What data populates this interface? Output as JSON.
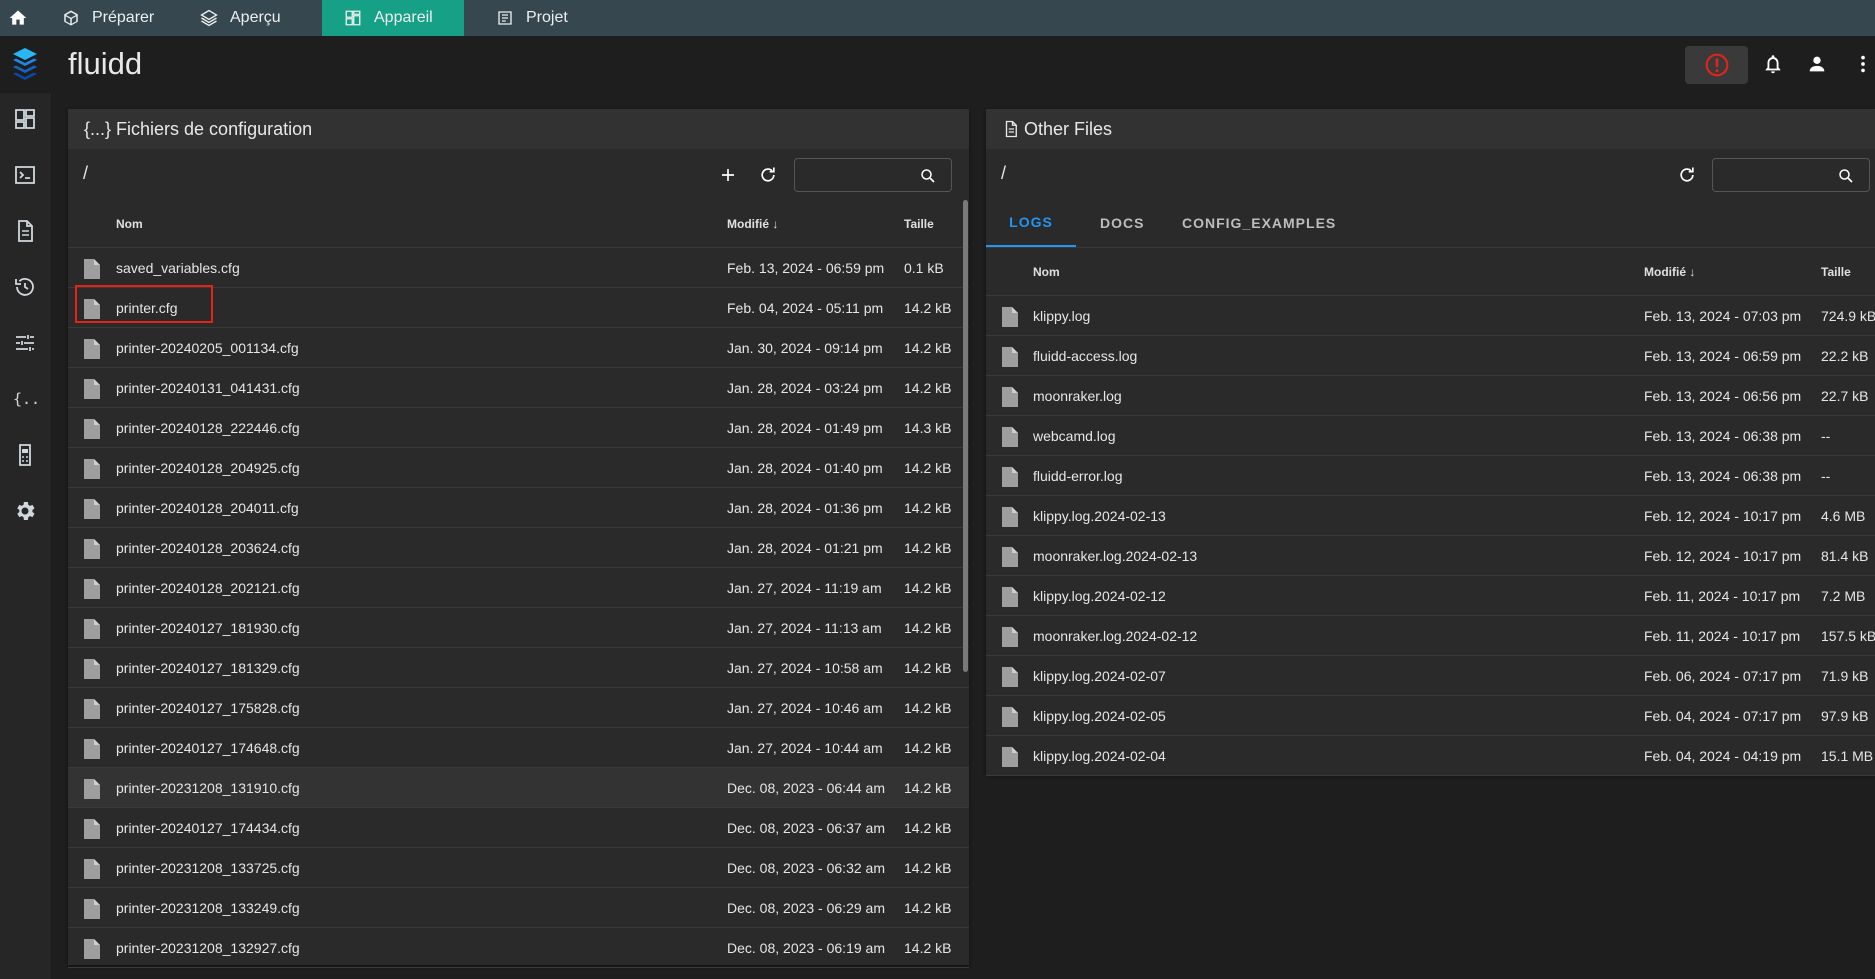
{
  "nav": {
    "tabs": [
      {
        "label": "Préparer"
      },
      {
        "label": "Aperçu"
      },
      {
        "label": "Appareil"
      },
      {
        "label": "Projet"
      }
    ]
  },
  "app": {
    "title": "fluidd"
  },
  "colors": {
    "accent": "#16a085",
    "tab_blue": "#2196f3",
    "alert_red": "#e0241b"
  },
  "config_card": {
    "title": "{...} Fichiers de configuration",
    "path": "/",
    "search": {
      "value": "",
      "placeholder": ""
    },
    "columns": {
      "name": "Nom",
      "modified": "Modifié",
      "size": "Taille"
    },
    "rows": [
      {
        "name": "saved_variables.cfg",
        "modified": "Feb. 13, 2024 - 06:59 pm",
        "size": "0.1 kB"
      },
      {
        "name": "printer.cfg",
        "modified": "Feb. 04, 2024 - 05:11 pm",
        "size": "14.2 kB"
      },
      {
        "name": "printer-20240205_001134.cfg",
        "modified": "Jan. 30, 2024 - 09:14 pm",
        "size": "14.2 kB"
      },
      {
        "name": "printer-20240131_041431.cfg",
        "modified": "Jan. 28, 2024 - 03:24 pm",
        "size": "14.2 kB"
      },
      {
        "name": "printer-20240128_222446.cfg",
        "modified": "Jan. 28, 2024 - 01:49 pm",
        "size": "14.3 kB"
      },
      {
        "name": "printer-20240128_204925.cfg",
        "modified": "Jan. 28, 2024 - 01:40 pm",
        "size": "14.2 kB"
      },
      {
        "name": "printer-20240128_204011.cfg",
        "modified": "Jan. 28, 2024 - 01:36 pm",
        "size": "14.2 kB"
      },
      {
        "name": "printer-20240128_203624.cfg",
        "modified": "Jan. 28, 2024 - 01:21 pm",
        "size": "14.2 kB"
      },
      {
        "name": "printer-20240128_202121.cfg",
        "modified": "Jan. 27, 2024 - 11:19 am",
        "size": "14.2 kB"
      },
      {
        "name": "printer-20240127_181930.cfg",
        "modified": "Jan. 27, 2024 - 11:13 am",
        "size": "14.2 kB"
      },
      {
        "name": "printer-20240127_181329.cfg",
        "modified": "Jan. 27, 2024 - 10:58 am",
        "size": "14.2 kB"
      },
      {
        "name": "printer-20240127_175828.cfg",
        "modified": "Jan. 27, 2024 - 10:46 am",
        "size": "14.2 kB"
      },
      {
        "name": "printer-20240127_174648.cfg",
        "modified": "Jan. 27, 2024 - 10:44 am",
        "size": "14.2 kB"
      },
      {
        "name": "printer-20231208_131910.cfg",
        "modified": "Dec. 08, 2023 - 06:44 am",
        "size": "14.2 kB"
      },
      {
        "name": "printer-20240127_174434.cfg",
        "modified": "Dec. 08, 2023 - 06:37 am",
        "size": "14.2 kB"
      },
      {
        "name": "printer-20231208_133725.cfg",
        "modified": "Dec. 08, 2023 - 06:32 am",
        "size": "14.2 kB"
      },
      {
        "name": "printer-20231208_133249.cfg",
        "modified": "Dec. 08, 2023 - 06:29 am",
        "size": "14.2 kB"
      },
      {
        "name": "printer-20231208_132927.cfg",
        "modified": "Dec. 08, 2023 - 06:19 am",
        "size": "14.2 kB"
      }
    ]
  },
  "other_card": {
    "title": "Other Files",
    "path": "/",
    "search": {
      "value": "",
      "placeholder": ""
    },
    "tabs": [
      {
        "label": "LOGS"
      },
      {
        "label": "DOCS"
      },
      {
        "label": "CONFIG_EXAMPLES"
      }
    ],
    "columns": {
      "name": "Nom",
      "modified": "Modifié",
      "size": "Taille"
    },
    "rows": [
      {
        "name": "klippy.log",
        "modified": "Feb. 13, 2024 - 07:03 pm",
        "size": "724.9 kB"
      },
      {
        "name": "fluidd-access.log",
        "modified": "Feb. 13, 2024 - 06:59 pm",
        "size": "22.2 kB"
      },
      {
        "name": "moonraker.log",
        "modified": "Feb. 13, 2024 - 06:56 pm",
        "size": "22.7 kB"
      },
      {
        "name": "webcamd.log",
        "modified": "Feb. 13, 2024 - 06:38 pm",
        "size": "--"
      },
      {
        "name": "fluidd-error.log",
        "modified": "Feb. 13, 2024 - 06:38 pm",
        "size": "--"
      },
      {
        "name": "klippy.log.2024-02-13",
        "modified": "Feb. 12, 2024 - 10:17 pm",
        "size": "4.6 MB"
      },
      {
        "name": "moonraker.log.2024-02-13",
        "modified": "Feb. 12, 2024 - 10:17 pm",
        "size": "81.4 kB"
      },
      {
        "name": "klippy.log.2024-02-12",
        "modified": "Feb. 11, 2024 - 10:17 pm",
        "size": "7.2 MB"
      },
      {
        "name": "moonraker.log.2024-02-12",
        "modified": "Feb. 11, 2024 - 10:17 pm",
        "size": "157.5 kB"
      },
      {
        "name": "klippy.log.2024-02-07",
        "modified": "Feb. 06, 2024 - 07:17 pm",
        "size": "71.9 kB"
      },
      {
        "name": "klippy.log.2024-02-05",
        "modified": "Feb. 04, 2024 - 07:17 pm",
        "size": "97.9 kB"
      },
      {
        "name": "klippy.log.2024-02-04",
        "modified": "Feb. 04, 2024 - 04:19 pm",
        "size": "15.1 MB"
      }
    ]
  },
  "icons": {
    "home": "home-icon",
    "prepare": "cube-icon",
    "preview": "layers-icon",
    "device": "device-icon",
    "project": "list-icon",
    "sidebar": [
      "dashboard-icon",
      "console-icon",
      "file-icon",
      "history-icon",
      "tune-icon",
      "code-braces-icon",
      "printer-icon",
      "settings-icon"
    ]
  }
}
